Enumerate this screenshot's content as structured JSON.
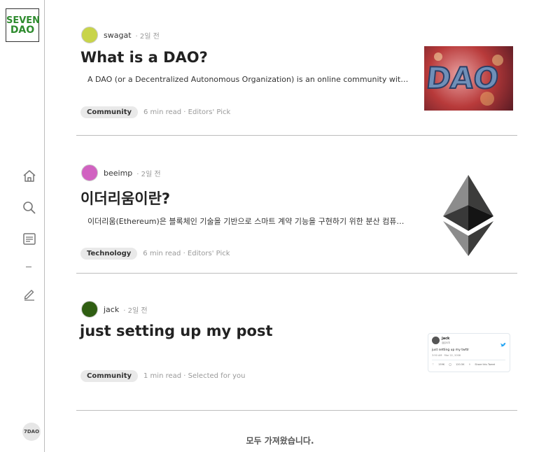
{
  "sidebar": {
    "logo_line1": "SEVEN",
    "logo_line2": "DAO",
    "footer_badge": "7DAO"
  },
  "posts": [
    {
      "author": "swagat",
      "time": "· 2일 전",
      "avatar_color": "#c8d44a",
      "title": "What is a DAO?",
      "excerpt": "A DAO (or a Decentralized Autonomous Organization) is an online community with decentralize…",
      "tag": "Community",
      "read_meta": "6 min read · Editors' Pick",
      "thumbnail": "dao-logo-image"
    },
    {
      "author": "beeimp",
      "time": "· 2일 전",
      "avatar_color": "#d162c1",
      "title": "이더리움이란?",
      "excerpt": "이더리움(Ethereum)은 블록체인 기술을 기반으로 스마트 계약 기능을 구현하기 위한 분산 컴퓨팅 플랫폼이…",
      "tag": "Technology",
      "read_meta": "6 min read · Editors' Pick",
      "thumbnail": "ethereum-logo-image"
    },
    {
      "author": "jack",
      "time": "· 2일 전",
      "avatar_color": "#2f5e12",
      "title": "just setting up my post",
      "excerpt": "",
      "tag": "Community",
      "read_meta": "1 min read · Selected for you",
      "thumbnail": "tweet-screenshot-image",
      "tweet": {
        "name": "jack",
        "handle": "@jack",
        "text": "just setting up my twttr",
        "date": "3:50 AM · Mar 22, 2006",
        "likes": "159K",
        "replies": "120.5K",
        "share": "Share this Tweet"
      }
    }
  ],
  "end_message": "모두 가져왔습니다."
}
